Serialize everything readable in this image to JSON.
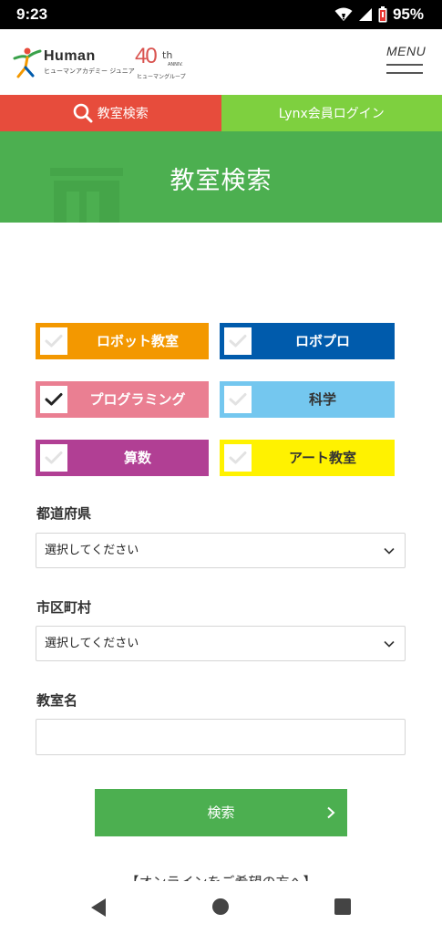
{
  "status_bar": {
    "time": "9:23",
    "battery": "95%"
  },
  "header": {
    "logo_word": "Human",
    "logo_sub": "ヒューマンアカデミー ジュニア",
    "anniv_num": "40",
    "anniv_th": "th",
    "anniv_label": "ANNIV.",
    "anniv_group": "ヒューマングループ",
    "menu_label": "MENU"
  },
  "top_buttons": {
    "search_label": "教室検索",
    "lynx_label": "Lynx会員ログイン"
  },
  "banner": {
    "title": "教室検索"
  },
  "categories": [
    {
      "label": "ロボット教室",
      "checked": false,
      "bg": "#f39800",
      "color": "#ffffff"
    },
    {
      "label": "ロボプロ",
      "checked": false,
      "bg": "#005bac",
      "color": "#ffffff"
    },
    {
      "label": "プログラミング",
      "checked": true,
      "bg": "#ea7f92",
      "color": "#ffffff"
    },
    {
      "label": "科学",
      "checked": false,
      "bg": "#74c7ef",
      "color": "#333333"
    },
    {
      "label": "算数",
      "checked": false,
      "bg": "#b13f94",
      "color": "#ffffff"
    },
    {
      "label": "アート教室",
      "checked": false,
      "bg": "#fff200",
      "color": "#333333"
    }
  ],
  "form": {
    "prefecture_label": "都道府県",
    "prefecture_value": "選択してください",
    "city_label": "市区町村",
    "city_value": "選択してください",
    "school_label": "教室名",
    "school_value": "",
    "submit_label": "検索"
  },
  "footer_partial": "【オンラインをご希望の方へ】",
  "colors": {
    "accent_green": "#4caf50",
    "search_red": "#e74c3c",
    "lynx_green": "#7ed03f"
  }
}
